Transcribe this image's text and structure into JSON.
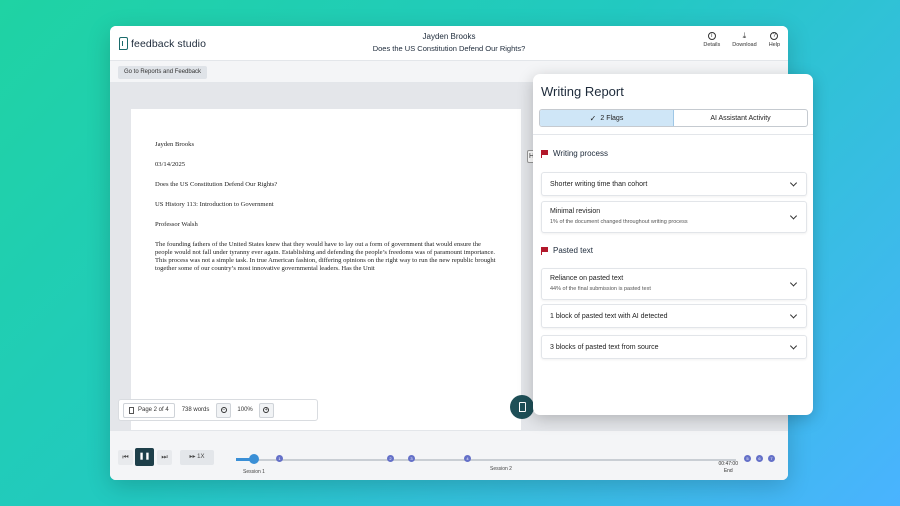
{
  "app": {
    "logo_text": "feedback studio",
    "author": "Jayden Brooks",
    "title": "Does the US Constitution Defend Our Rights?",
    "actions": [
      {
        "label": "Details",
        "icon": "info-icon"
      },
      {
        "label": "Download",
        "icon": "download-icon"
      },
      {
        "label": "Help",
        "icon": "help-icon"
      }
    ]
  },
  "subbar": {
    "back_label": "Go to Reports and Feedback"
  },
  "document": {
    "author": "Jayden Brooks",
    "date": "03/14/2025",
    "title": "Does the US Constitution Defend Our Rights?",
    "course": "US History 113: Introduction to Government",
    "professor": "Professor Walsh",
    "body": "The founding fathers of the United States knew that they would have to lay out a form of government that would ensure the people would not fall under tyranny ever again. Establishing and defending the people’s freedoms was of paramount importance. This process was not a simple task. In true American fashion, differing opinions on the right way to run the new republic brought together some of our country’s most innovative governmental leaders. Has the Unit"
  },
  "doc_toolbar": {
    "page_label": "Page 2 of 4",
    "words": "738 words",
    "zoom": "100%"
  },
  "side_toggle": "H",
  "playback": {
    "speed": "1X",
    "progress_fraction": 0.04,
    "session_1": "Session 1",
    "session_2": "Session 2",
    "time": "00:47:00",
    "end": "End",
    "markers": [
      "1",
      "2",
      "3",
      "4",
      "5",
      "6",
      "7"
    ]
  },
  "report": {
    "title": "Writing Report",
    "tab_flags": "2 Flags",
    "tab_ai": "AI Assistant Activity",
    "sections": [
      {
        "heading": "Writing process",
        "items": [
          {
            "title": "Shorter writing time than cohort",
            "sub": ""
          },
          {
            "title": "Minimal revision",
            "sub": "1% of the document changed throughout writing process"
          }
        ]
      },
      {
        "heading": "Pasted text",
        "items": [
          {
            "title": "Reliance on pasted text",
            "sub": "44% of the final submission is pasted text"
          },
          {
            "title": "1 block of pasted text with AI detected",
            "sub": ""
          },
          {
            "title": "3 blocks of pasted text from source",
            "sub": ""
          }
        ]
      }
    ]
  },
  "colors": {
    "accent": "#1e4f57",
    "flag": "#b2182b",
    "progress": "#3a8fd6",
    "marker": "#6470c8",
    "tab_active": "#cfe6f7"
  }
}
